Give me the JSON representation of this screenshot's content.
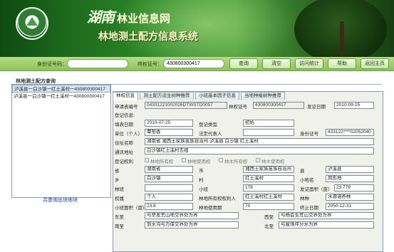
{
  "header": {
    "brand": "湖南",
    "site_name": "林业信息网",
    "system_name": "林地测土配方信息系统"
  },
  "search": {
    "id_label": "身份证号码：",
    "id_value": "",
    "cert_label": "林权证号：",
    "cert_value": "430800300417",
    "buttons": [
      "查询",
      "清空",
      "访问统计",
      "帮助",
      "返回主页"
    ]
  },
  "left": {
    "title": "林地测土配方查询",
    "items": [
      "泸溪县一白沙镇一红土溪村一430800300417",
      "泸溪县一白沙镇一红土溪村一430800300417"
    ],
    "shared_link": "共查询出块地块"
  },
  "tabs": [
    "林权信息",
    "测土配方适生树种推荐",
    "小班基本因子信息",
    "当地种植树种推荐"
  ],
  "form": {
    "apply_no_label": "申请表编号",
    "apply_no": "04331221002026DTWSTD0057",
    "cert_no_label": "林权证号",
    "cert_no": "430800300417",
    "issue_date_label": "发证日期",
    "issue_date": "2010-09-25",
    "reg_info_label": "登记信息:",
    "fill_date_label": "填表日期",
    "fill_date": "2010-07-25",
    "reg_type_label": "登记类型",
    "reg_type": "初始",
    "unit_label": "单位（个人）",
    "unit": "覃萄香",
    "legal_rep_label": "法定代表人",
    "legal_rep": "",
    "idcard_label": "身份证号",
    "idcard": "433122****02052040",
    "addr_label": "住址名称",
    "addr": "湖南省 湘西土家族苗族自治州 泸溪县 白沙镇 红土溪村",
    "comm_addr_label": "通讯地址",
    "comm_addr": "白沙镇红土溪村五组",
    "rights_label": "登记权利",
    "rights": [
      "林地所有权",
      "林地使用权",
      "林木所有权",
      "林木使用权"
    ],
    "province_label": "省",
    "province": "湖南省",
    "city_label": "市",
    "city": "湘西土家族苗族自治州",
    "county_label": "县",
    "county": "泸溪县",
    "town_label": "乡",
    "town": "白沙镇",
    "village_label": "村",
    "village": "红土溪村",
    "place_label": "小地名",
    "place": "凤形地",
    "forest_class_label": "林班",
    "forest_class": "",
    "subcompart_label": "小班",
    "subcompart": "178",
    "area_label": "发证面积（亩）",
    "area": "23.779",
    "ownership_label": "权属",
    "ownership": "个人",
    "owner_label": "林地所有权权利人",
    "owner": "红土溪村红土溪村",
    "species_label": "林种",
    "species": "水源涵养林",
    "sub_area_label": "小班面积（亩）",
    "sub_area": "23.8",
    "use_term_label": "林地使用期",
    "use_term": "70",
    "end_date_label": "终止日期",
    "end_date": "2050-12-31",
    "east_label": "东至",
    "east": "与早发荒山地交界处为界",
    "west_label": "西至",
    "west": "与杨会生荒山交界处为界",
    "south_label": "南至",
    "south": "到水沟与万保交界处为界",
    "north_label": "北至",
    "north": "与屋场坪分水为界"
  }
}
